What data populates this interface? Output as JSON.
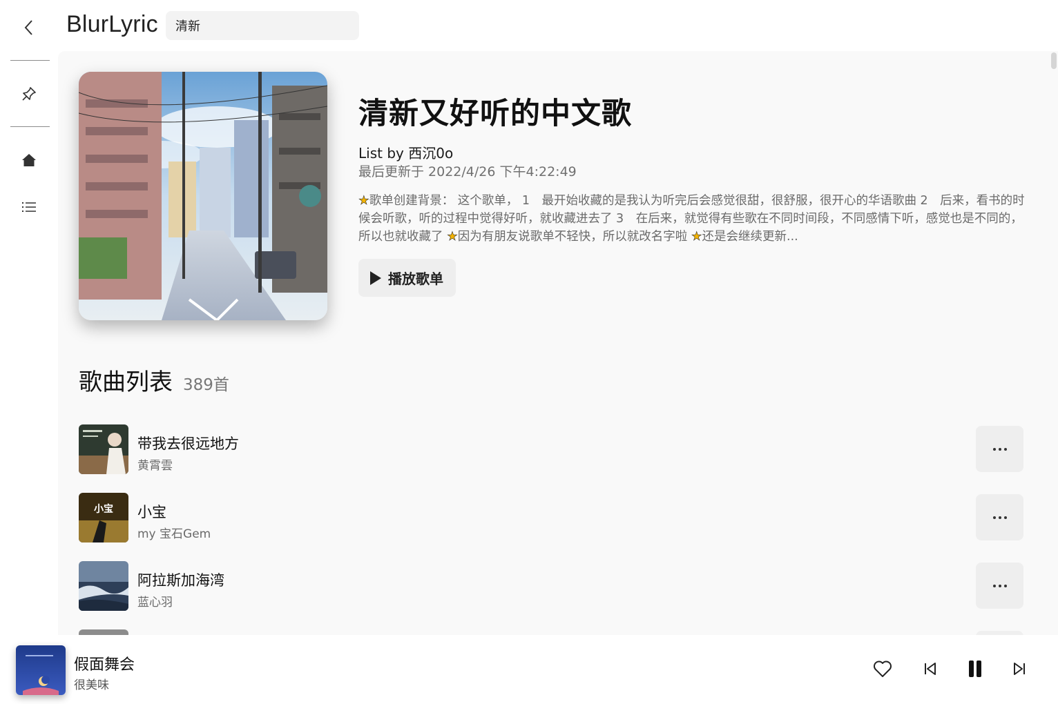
{
  "app": {
    "title": "BlurLyric"
  },
  "search": {
    "value": "清新"
  },
  "sidebar": {
    "items": [
      {
        "icon": "pin-icon"
      },
      {
        "icon": "home-icon"
      },
      {
        "icon": "list-icon"
      }
    ]
  },
  "playlist": {
    "title": "清新又好听的中文歌",
    "author_prefix": "List by ",
    "author": "西沉0o",
    "updated": "最后更新于 2022/4/26 下午4:22:49",
    "description": {
      "part1": "歌单创建背景： 这个歌单， 1　最开始收藏的是我认为听完后会感觉很甜，很舒服，很开心的华语歌曲 2　后来，看书的时候会听歌，听的过程中觉得好听，就收藏进去了 3　在后来，就觉得有些歌在不同时间段，不同感情下听，感觉也是不同的，所以也就收藏了 ",
      "part2": "因为有朋友说歌单不轻快，所以就改名字啦 ",
      "part3": "还是会继续更新..."
    },
    "play_button": "播放歌单"
  },
  "songs_section": {
    "title": "歌曲列表",
    "count": "389首",
    "songs": [
      {
        "name": "带我去很远地方",
        "artist": "黄霄雲"
      },
      {
        "name": "小宝",
        "artist": "my  宝石Gem",
        "cover_text": "小宝"
      },
      {
        "name": "阿拉斯加海湾",
        "artist": "蓝心羽"
      }
    ]
  },
  "now_playing": {
    "title": "假面舞会",
    "artist": "很美味"
  },
  "colors": {
    "accent_star": "#f5b400",
    "panel_bg": "#f9f9f9",
    "button_bg": "#eeeeee"
  }
}
